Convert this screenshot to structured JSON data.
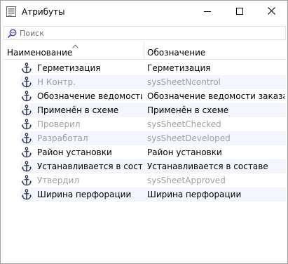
{
  "window": {
    "title": "Атрибуты",
    "icon": "attributes-icon",
    "controls": {
      "minimize": "minimize-icon",
      "maximize": "maximize-icon",
      "close": "close-icon"
    }
  },
  "search": {
    "placeholder": "Поиск",
    "value": "",
    "icon": "search-icon"
  },
  "table": {
    "columns": [
      {
        "label": "Наименование",
        "sort": "ascending"
      },
      {
        "label": "Обозначение"
      }
    ],
    "rows": [
      {
        "name": "Герметизация",
        "designation": "Герметизация",
        "enabled": true
      },
      {
        "name": "Н Контр.",
        "designation": "sysSheetNcontrol",
        "enabled": false
      },
      {
        "name": "Обозначение ведомости ...",
        "designation": "Обозначение ведомости заказа",
        "enabled": true
      },
      {
        "name": "Применён в схеме",
        "designation": "Применён в схеме",
        "enabled": true
      },
      {
        "name": "Проверил",
        "designation": "sysSheetChecked",
        "enabled": false
      },
      {
        "name": "Разработал",
        "designation": "sysSheetDeveloped",
        "enabled": false
      },
      {
        "name": "Район установки",
        "designation": "Район установки",
        "enabled": true
      },
      {
        "name": "Устанавливается в составе",
        "designation": "Устанавливается в составе",
        "enabled": true
      },
      {
        "name": "Утвердил",
        "designation": "sysSheetApproved",
        "enabled": false
      },
      {
        "name": "Ширина перфорации",
        "designation": "Ширина перфорации",
        "enabled": true
      }
    ],
    "row_icon": "anchor-icon"
  },
  "colors": {
    "text": "#000000",
    "disabled_text": "#a0a0a0",
    "row_stripe": "#f3f6fc",
    "accent": "#5b3fb5",
    "border": "#a0a0a0"
  }
}
